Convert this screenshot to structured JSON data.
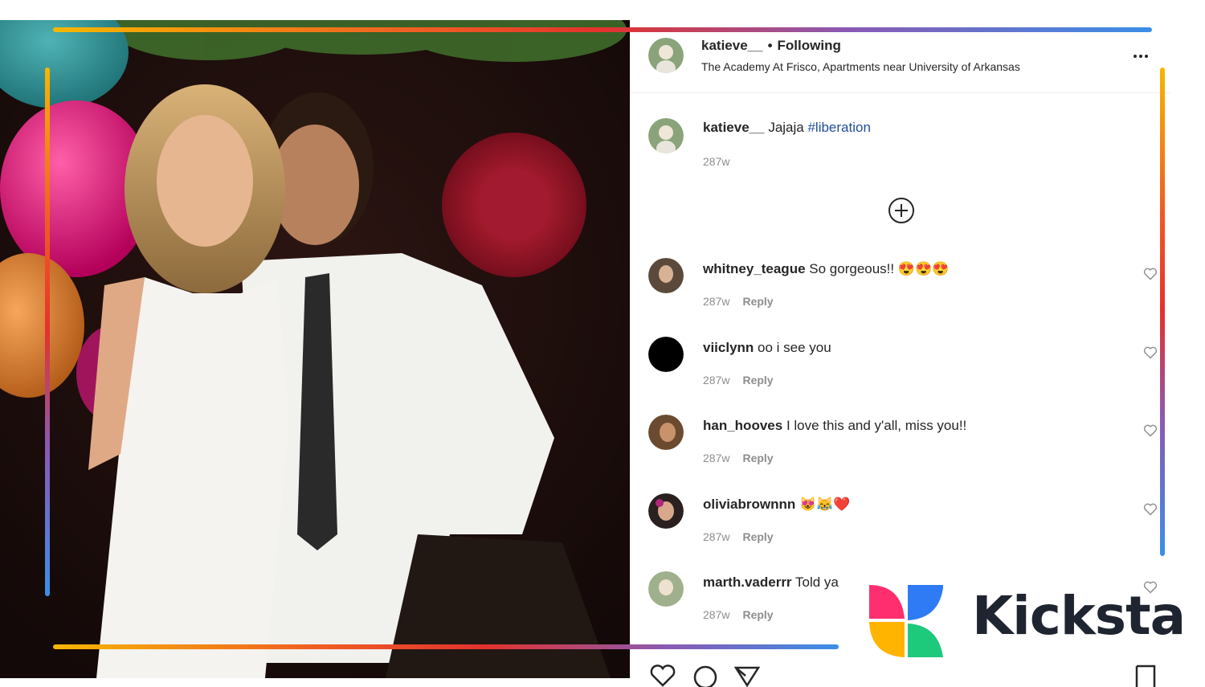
{
  "post": {
    "author": "katieve__",
    "separator": "•",
    "follow_status": "Following",
    "location": "The Academy At Frisco, Apartments near University of Arkansas",
    "caption_text": "Jajaja",
    "caption_hashtag": "#liberation",
    "caption_time": "287w"
  },
  "comments": [
    {
      "user": "whitney_teague",
      "text": "So gorgeous!! 😍😍😍",
      "time": "287w",
      "reply": "Reply"
    },
    {
      "user": "viiclynn",
      "text": "oo i see you",
      "time": "287w",
      "reply": "Reply"
    },
    {
      "user": "han_hooves",
      "text": "I love this and y'all, miss you!!",
      "time": "287w",
      "reply": "Reply"
    },
    {
      "user": "oliviabrownnn",
      "text": "😻😹❤️",
      "time": "287w",
      "reply": "Reply"
    },
    {
      "user": "marth.vaderrr",
      "text": "Told ya",
      "time": "287w",
      "reply": "Reply"
    }
  ],
  "brand": {
    "name": "Kicksta"
  },
  "colors": {
    "gradient_start": "#f6b700",
    "gradient_mid": "#e3322d",
    "gradient_end": "#3b8fe8",
    "hashtag": "#1f4f9b",
    "brand_text": "#1f2530"
  },
  "icons": {
    "more": "more-options-icon",
    "add": "plus-circle-icon",
    "like": "heart-icon",
    "comment": "comment-icon",
    "share": "share-icon",
    "save": "bookmark-icon"
  }
}
